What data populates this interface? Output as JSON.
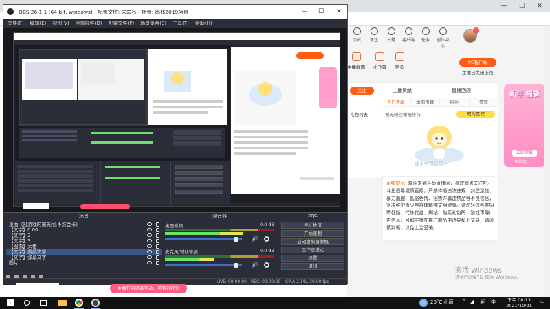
{
  "obs": {
    "title": "OBS 26.1.1 (64-bit, windows) - 配置文件: 未命名 - 场景: 比比2019场景",
    "menu": [
      "文件(F)",
      "编辑(E)",
      "视图(V)",
      "停靠部件(D)",
      "配置文件(P)",
      "场景集合(S)",
      "工具(T)",
      "帮助(H)"
    ],
    "docks": {
      "scenes": "场景",
      "mixer": "混音器",
      "controls": "控件"
    },
    "sources": [
      {
        "label": "桌面（打游戏时需关闭,不然会卡）",
        "selected": false
      },
      {
        "label": "【文字】0.00",
        "selected": false
      },
      {
        "label": "【文字】2",
        "selected": false
      },
      {
        "label": "【文字】3",
        "selected": false
      },
      {
        "label": "【图像】大佬",
        "selected": false
      },
      {
        "label": "【文字】美颜文字",
        "selected": true
      },
      {
        "label": "【文字】弹幕文字",
        "selected": false
      },
      {
        "label": "图片",
        "selected": false
      }
    ],
    "mixer": [
      {
        "name": "桌面音频",
        "db": "0.0 dB",
        "level": 0.72,
        "volume": 0.92
      },
      {
        "name": "麦克风/辅助音频",
        "db": "0.0 dB",
        "level": 0.45,
        "volume": 0.92
      }
    ],
    "controls": [
      "停止推流",
      "开始录制",
      "启动虚拟摄像机",
      "工作室模式",
      "设置",
      "退出"
    ],
    "status": {
      "live": "LIVE: 00:00:00",
      "rec": "REC: 00:00:00",
      "cpu": "CPU: 2.1%, 30.00 fps"
    }
  },
  "site": {
    "nav": [
      "历史",
      "关注",
      "开播",
      "客户端",
      "任务",
      "创作中心"
    ],
    "avatar_badge": "1",
    "tools": [
      "主播截图",
      "小飞碟",
      "更多"
    ],
    "pc_button": "PC客户端",
    "close_room": "主播已关闭上线",
    "follow": "关注",
    "rank_header1": "主播贡献",
    "rank_header2": "直播回顾",
    "rank_tabs": [
      "今日贡献",
      "本周贡献",
      "粉丝",
      "贵宾"
    ],
    "gift_list": "礼物列表",
    "rank_note": "暂无粉丝举报排行",
    "lucky_btn": "成为贵宾",
    "empty_note": "还木有粉丝哦~",
    "system_notice_tag": "系统提示:",
    "system_notice": "欢迎来到斗鱼直播间，喜欢就点关注吧。斗鱼倡导健康直播，严禁传播违法违规、封建迷信、暴力血腥、低俗色情、招嫖诈骗违禁品等不良信息，坚决维护青少年群体精神文明健康。请勿轻信各类招聘征婚、代练代抽、刷钻、购买礼包码、游戏币等广告信息，且如主播在推广商品中诱导私下交易，请谨慎判断，以免上当受骗。",
    "ad_title": "新年 福袋",
    "ad_sub": "立即领取",
    "ad_sub2": "去抽奖"
  },
  "activation": {
    "line1": "激活 Windows",
    "line2": "转到“设置”以激活 Windows。"
  },
  "overlay": {
    "red_btn": "主播开启语音互动，可有效提升"
  },
  "taskbar": {
    "weather": "20°C 小雨",
    "time": "下午 08:13",
    "date": "2021/10/21",
    "lang": "中"
  },
  "colors": {
    "obs_bg": "#2b2e38",
    "accent": "#ff5b13",
    "selected": "#395581"
  }
}
